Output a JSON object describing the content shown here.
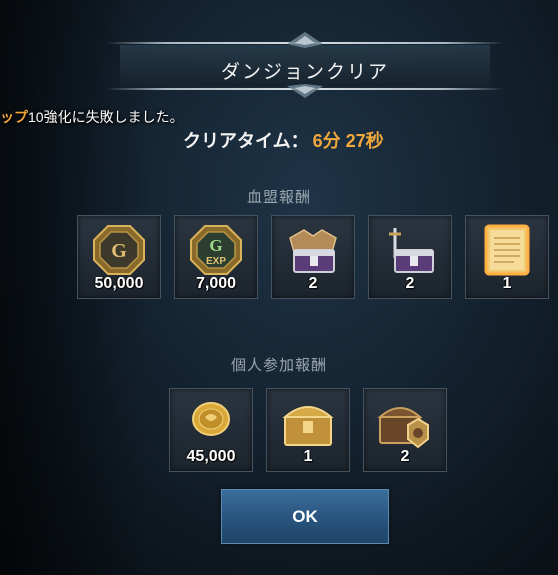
{
  "dialog": {
    "title": "ダンジョンクリア",
    "notice_highlight": "ップ",
    "notice_rest": "10強化に失敗しました。",
    "clear_time_label": "クリアタイム：",
    "clear_time_value": "6分 27秒"
  },
  "guild_rewards": {
    "title": "血盟報酬",
    "items": [
      {
        "icon": "gold-coin-g-icon",
        "quantity": "50,000"
      },
      {
        "icon": "exp-coin-icon",
        "quantity": "7,000"
      },
      {
        "icon": "armor-chest-icon",
        "quantity": "2"
      },
      {
        "icon": "weapon-chest-icon",
        "quantity": "2"
      },
      {
        "icon": "scroll-icon",
        "quantity": "1"
      }
    ]
  },
  "personal_rewards": {
    "title": "個人参加報酬",
    "items": [
      {
        "icon": "gold-coin-icon",
        "quantity": "45,000"
      },
      {
        "icon": "golden-chest-icon",
        "quantity": "1"
      },
      {
        "icon": "crest-chest-icon",
        "quantity": "2"
      }
    ]
  },
  "ok_button": {
    "label": "OK"
  },
  "colors": {
    "accent": "#f2a93b",
    "button": "#2a5680",
    "section_title": "#9aa6b0"
  }
}
